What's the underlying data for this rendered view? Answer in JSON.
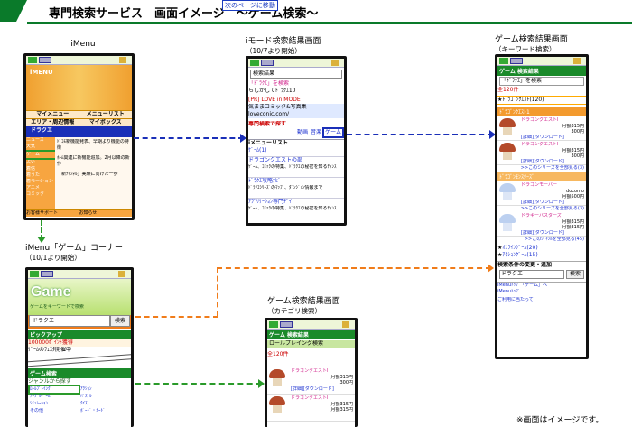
{
  "header": {
    "title": "専門検索サービス　画面イメージ　～ゲーム検索～",
    "jump_label": "次のページに移動"
  },
  "captions": {
    "imenu": "iMenu",
    "imode_result": "iモード検索結果画面",
    "imode_result_sub": "（10/7より開始）",
    "game_kw": "ゲーム検索結果画面",
    "game_kw_sub": "（キーワード検索）",
    "imenu_game": "iMenu「ゲーム」コーナー",
    "imenu_game_sub": "（10/1より開始）",
    "game_cat": "ゲーム検索結果画面",
    "game_cat_sub": "（カテゴリ検索）"
  },
  "imenu": {
    "banner": "iMENU",
    "my_menu": "マイメニュー",
    "menu_list": "メニューリスト",
    "area": "エリア・周辺情報",
    "my_box": "マイボックス",
    "search_value": "ドラクエ",
    "left_items": [
      "ニュース",
      "天気",
      "ゲーム",
      "占い",
      "着信",
      "着うた",
      "着モーション",
      "アニメ",
      "コミック"
    ],
    "right_items": [
      "ﾄﾞｺﾓ新機能発表、早期より機能の特徴",
      "ﾎｰﾑ関連に新機能追加。2月以降の新作",
      "「新ﾁｬﾝﾈﾙ」実験に向けた一歩"
    ],
    "footer_left": "お客様サポート",
    "footer_right": "お知らせ"
  },
  "imode_result": {
    "search_box": "検索結果",
    "r1_title": "「ﾄﾞﾗｸｴ」を検索",
    "r1_line": "らしかしてﾄﾞﾗｸｴ10",
    "r2_title": "[PR] LOVE in MODE",
    "r2_line1": "気ままコミック&写真集",
    "r2_line2": "loveconic.com/",
    "special_label": "専門検索で探す",
    "links": [
      "動画",
      "音楽",
      "ゲーム"
    ],
    "sec_menu": "iメニューリスト",
    "sec_menu_link": "ｹﾞｰﾑ(1)",
    "rows": [
      {
        "title": "ドラゴンクエストの部",
        "body": "ｹﾞｰﾑ、ｺﾐｯｸの特集、ﾄﾞﾗｸｴの秘密を知るﾁｬﾝｽ"
      },
      {
        "title": "ﾄﾞﾗｸｴ攻略ﾅﾋﾞ",
        "body": "ﾄﾞﾗｸｴｼﾘｰｽﾞのﾏｯﾌﾟ、ﾀﾞﾝｼﾞｮﾝ情報まで"
      },
      {
        "title": "ｱﾌﾟﾘｹｰｼｮﾝ専門ﾃﾞｲ",
        "body": "ｹﾞｰﾑ、ｺﾐｯｸの特集、ﾄﾞﾗｸｴの秘密を知るﾁｬﾝｽ"
      }
    ]
  },
  "game_kw": {
    "head": "ゲーム 検索結果",
    "query": "「ﾄﾞﾗｸｴ」を検索",
    "count": "全120件",
    "dragon_row": "ﾄﾞﾗｺﾞﾝｸｴｽﾄ(120)",
    "bands": [
      "ﾄﾞﾗｺﾞﾝｸｴｽﾄ1",
      "ﾄﾞﾗｺﾞﾝｸｴｽﾄ2",
      "ﾄﾞﾗｺﾞﾝﾓﾝｽﾀｰｽﾞ"
    ],
    "items": [
      {
        "title": "ドラゴンクエストI",
        "lines": [
          "月額315円",
          "300円"
        ],
        "links": "[詳細][ダウンロード]"
      },
      {
        "title": "ドラゴンクエストI",
        "lines": [
          "月額315円",
          "300円"
        ],
        "links": "[詳細][ダウンロード]"
      },
      {
        "title": "ドラゴンモーバー",
        "lines": [
          "docomo",
          "月額500円"
        ],
        "links": "[詳細][ダウンロード]"
      },
      {
        "title": "ドラゴンモーバー",
        "lines": [
          "docomo",
          "月額500円"
        ],
        "links": "[詳細][ダウンロード]"
      },
      {
        "title": "ドラキーバスターズ",
        "lines": [
          "月額315円",
          "月額315円"
        ],
        "links": "[詳細][ダウンロード]"
      }
    ],
    "more": ">>このシリーズを全部見る(3)",
    "more2": ">>このｼﾞｬﾝﾙを全部見る(45)",
    "star1": "ｵﾝﾗｲﾝｹﾞｰﾑ(20)",
    "star2": "ｱｸｼｮﾝｹﾞｰﾑ(15)",
    "change_label": "検索条件の変更・追加",
    "change_value": "ドラクエ",
    "change_button": "検索",
    "foot1": "iMenuﾄｯﾌﾟ「ゲーム」へ",
    "foot2": "iMenuﾄｯﾌﾟ",
    "foot3": "ご利用に当たって"
  },
  "imenu_game": {
    "game_logo": "Game",
    "search_label": "ゲームをキーワードで検索",
    "input_value": "ドラクエ",
    "button": "検索",
    "pickup": "ピックアップ",
    "pickup_body": "ｹﾞｰﾑのﾌｪｽﾀ開催中",
    "hours": "100000ﾎﾟｲﾝﾄ獲得",
    "cat_head": "ゲーム検索",
    "cat_sub": "ジャンルから探す",
    "categories": [
      "ﾛｰﾙﾌﾟﾚｲﾝｸﾞ",
      "ｱｸｼｮﾝ",
      "ﾃｰﾌﾞﾙｹﾞｰﾑ",
      "ｼﾐｭﾚｰｼｮﾝ",
      "その他",
      "ﾊﾟｽﾞﾙ",
      "ｸｲｽﾞ",
      "ﾎﾞｰﾄﾞ・ｶｰﾄﾞ"
    ]
  },
  "game_cat": {
    "head": "ゲーム 検索結果",
    "query": "ロールプレイング検索",
    "count": "全120件",
    "items": [
      {
        "title": "ドラゴンクエストI",
        "lines": [
          "月額315円",
          "300円"
        ],
        "links": "[詳細][ダウンロード]"
      },
      {
        "title": "ドラゴンクエストI",
        "lines": [
          "月額315円",
          "月額315円"
        ],
        "links": "[詳細][ダウンロード]"
      }
    ]
  },
  "note": "※画面はイメージです。"
}
